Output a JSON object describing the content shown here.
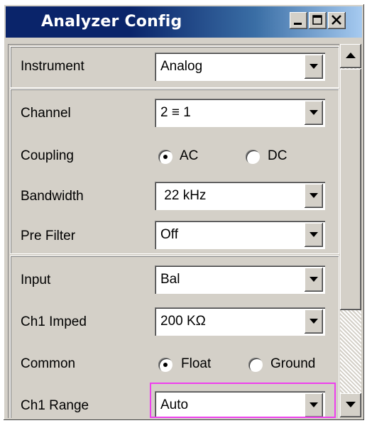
{
  "window": {
    "title": "Analyzer Config",
    "buttons": [
      "minimize-icon",
      "maximize-icon",
      "close-icon"
    ]
  },
  "rows": {
    "instrument": {
      "label": "Instrument",
      "value": "Analog"
    },
    "channel": {
      "label": "Channel",
      "value": "2 ≡ 1"
    },
    "coupling": {
      "label": "Coupling",
      "options": [
        "AC",
        "DC"
      ],
      "selected": "AC"
    },
    "bandwidth": {
      "label": "Bandwidth",
      "value": " 22 kHz"
    },
    "prefilter": {
      "label": "Pre Filter",
      "value": "Off"
    },
    "input": {
      "label": "Input",
      "value": "Bal"
    },
    "ch1imped": {
      "label": "Ch1 Imped",
      "value": "200 KΩ"
    },
    "common": {
      "label": "Common",
      "options": [
        "Float",
        "Ground"
      ],
      "selected": "Float"
    },
    "ch1range": {
      "label": "Ch1 Range",
      "value": "Auto"
    }
  },
  "colors": {
    "title_bar": "#0a246a",
    "highlight_border": "#ee3fee",
    "face": "#d4d0c8"
  }
}
